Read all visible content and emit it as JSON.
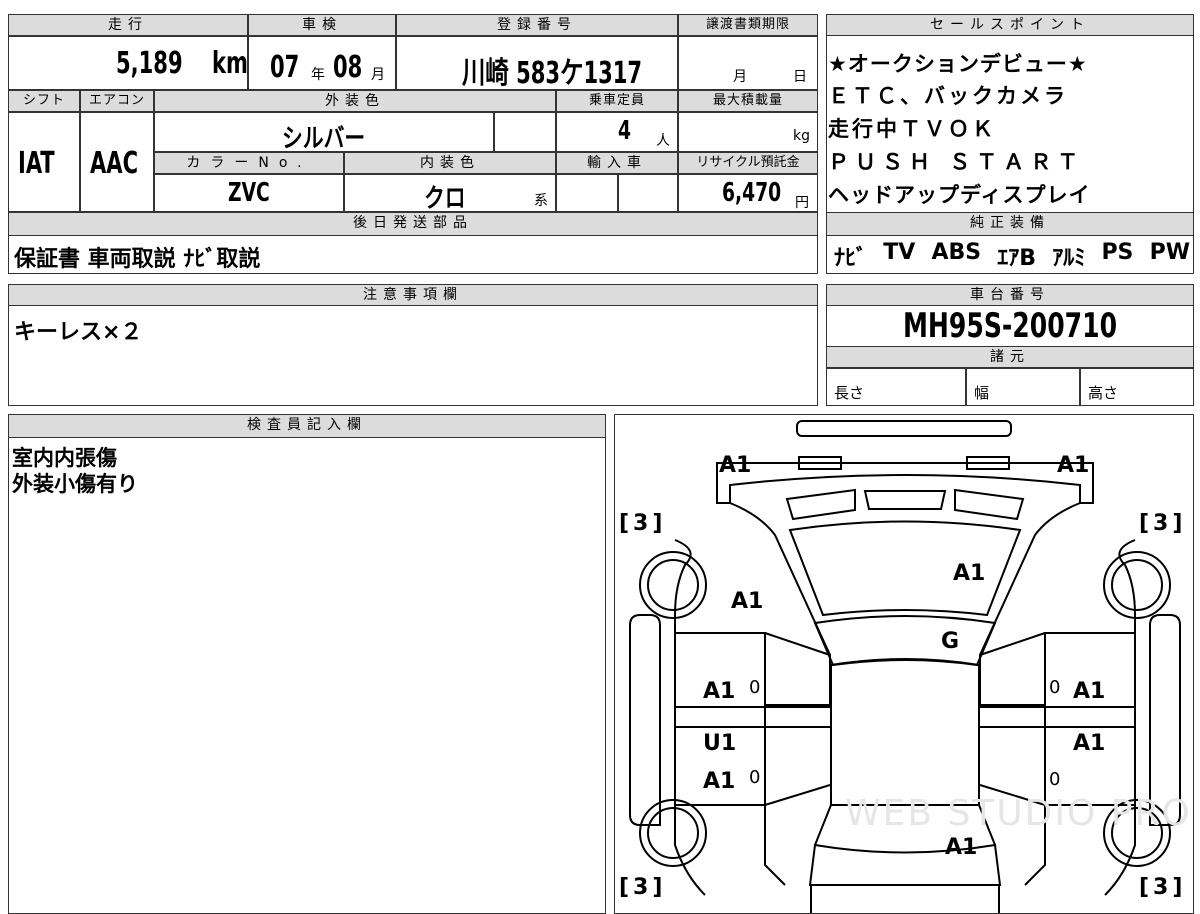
{
  "top": {
    "mileage_label": "走行",
    "mileage": "5,189",
    "mileage_unit": "km",
    "inspection_label": "車検",
    "insp_year": "07",
    "insp_year_unit": "年",
    "insp_month": "08",
    "insp_month_unit": "月",
    "reg_label": "登録番号",
    "reg_number": "川崎 583ケ1317",
    "deadline_label": "譲渡書類期限",
    "deadline_month": "月",
    "deadline_day": "日"
  },
  "row2": {
    "shift_label": "シフト",
    "shift": "IAT",
    "ac_label": "エアコン",
    "ac": "AAC",
    "exterior_label": "外装色",
    "exterior": "シルバー",
    "capacity_label": "乗車定員",
    "capacity": "4",
    "capacity_unit": "人",
    "maxload_label": "最大積載量",
    "maxload_unit": "kg",
    "color_no_label": "カラーNo.",
    "color_no": "ZVC",
    "interior_label": "内装色",
    "interior": "クロ",
    "interior_unit": "系",
    "import_label": "輸入車",
    "recycle_label": "リサイクル預託金",
    "recycle": "6,470",
    "recycle_unit": "円"
  },
  "later_parts": {
    "label": "後日発送部品",
    "text": "保証書 車両取説 ﾅﾋﾞ取説"
  },
  "sales_points": {
    "label": "セールスポイント",
    "lines": [
      "★オークションデビュー★",
      "ＥＴＣ、バックカメラ",
      "走行中ＴＶＯＫ",
      "ＰＵＳＨ ＳＴＡＲＴ",
      "ヘッドアップディスプレイ"
    ]
  },
  "genuine_equipment": {
    "label": "純正装備",
    "items": [
      "ﾅﾋﾞ",
      "TV",
      "ABS",
      "ｴｱB",
      "ｱﾙﾐ",
      "PS",
      "PW"
    ]
  },
  "notes": {
    "label": "注意事項欄",
    "text": "キーレス×２"
  },
  "chassis": {
    "label": "車台番号",
    "number": "MH95S-200710"
  },
  "specs": {
    "label": "諸元",
    "length": "長さ",
    "width": "幅",
    "height": "高さ"
  },
  "inspector": {
    "label": "検査員記入欄",
    "lines": [
      "室内内張傷",
      "外装小傷有り"
    ]
  },
  "diagram": {
    "a1_tl": "A1",
    "a1_tr": "A1",
    "bracket_tl": "[3]",
    "bracket_tr": "[3]",
    "bracket_bl": "[3]",
    "bracket_br": "[3]",
    "a1_hood": "A1",
    "a1_fender_l": "A1",
    "g_windshield": "G",
    "a1_door_fl": "A1",
    "a1_door_fr": "A1",
    "u1_door_rl": "U1",
    "a1_door_rl": "A1",
    "a1_door_rr": "A1",
    "a1_rear": "A1",
    "zero_1": "0",
    "zero_2": "0",
    "zero_3": "0",
    "zero_4": "0",
    "watermark": "WEB STUDIO PRO"
  }
}
